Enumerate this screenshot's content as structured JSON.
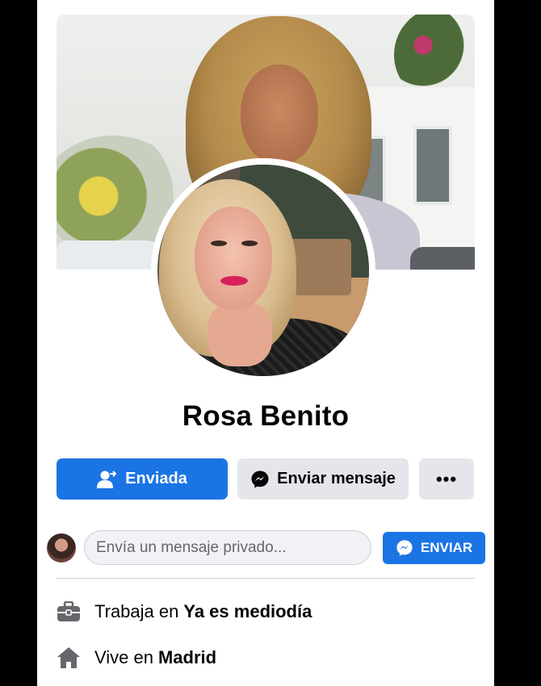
{
  "profile": {
    "name": "Rosa Benito"
  },
  "actions": {
    "friend_request_label": "Enviada",
    "message_label": "Enviar mensaje",
    "more_label": "•••"
  },
  "message_box": {
    "placeholder": "Envía un mensaje privado...",
    "send_label": "ENVIAR"
  },
  "about": {
    "work_prefix": "Trabaja en",
    "work_value": "Ya es mediodía",
    "home_prefix": "Vive en",
    "home_value": "Madrid"
  },
  "colors": {
    "primary": "#1b74e4",
    "secondary_bg": "#e4e6eb",
    "text": "#050505",
    "icon_gray": "#65676b"
  },
  "icons": [
    "user-check-icon",
    "messenger-icon",
    "more-icon",
    "briefcase-icon",
    "home-icon"
  ]
}
